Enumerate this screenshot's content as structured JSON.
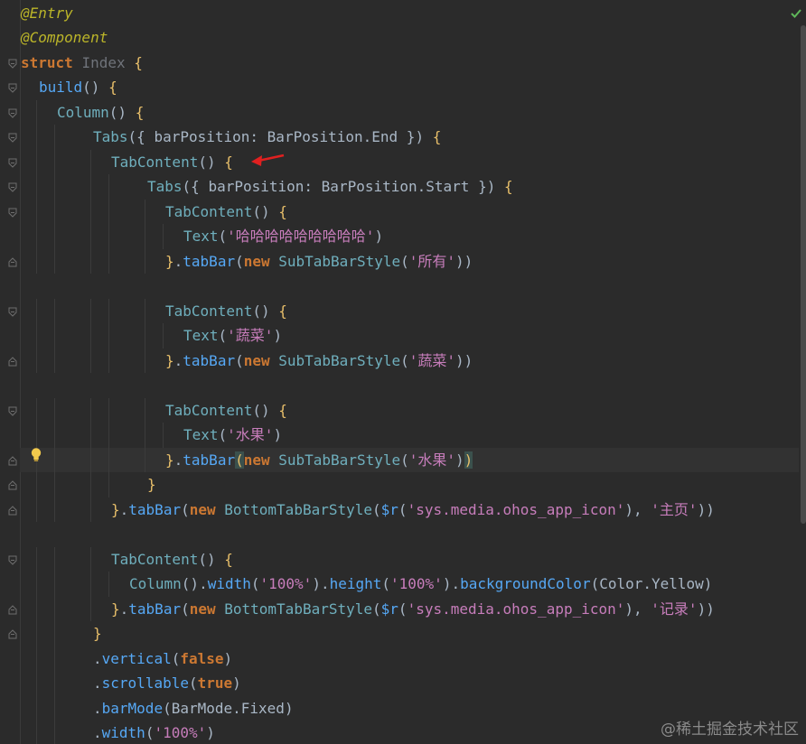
{
  "editor": {
    "status_check_icon": "checkmark-icon",
    "watermark": "@稀土掘金技术社区",
    "lines": [
      [
        {
          "t": "@Entry",
          "c": "annotation"
        }
      ],
      [
        {
          "t": "@Component",
          "c": "annotation"
        }
      ],
      [
        {
          "t": "struct ",
          "c": "kw-bold"
        },
        {
          "t": "Index ",
          "c": "ident-dim"
        },
        {
          "t": "{",
          "c": "br-yellow"
        }
      ],
      [
        {
          "t": "build",
          "c": "fn"
        },
        {
          "t": "() ",
          "c": "plain"
        },
        {
          "t": "{",
          "c": "br-yellow"
        }
      ],
      [
        {
          "t": "Column",
          "c": "comp"
        },
        {
          "t": "() ",
          "c": "plain"
        },
        {
          "t": "{",
          "c": "br-yellow"
        }
      ],
      [
        {
          "t": "Tabs",
          "c": "comp"
        },
        {
          "t": "({ ",
          "c": "plain"
        },
        {
          "t": "barPosition",
          "c": "prop"
        },
        {
          "t": ": ",
          "c": "plain"
        },
        {
          "t": "BarPosition",
          "c": "cls"
        },
        {
          "t": ".End }) ",
          "c": "plain"
        },
        {
          "t": "{",
          "c": "br-yellow"
        }
      ],
      [
        {
          "t": "TabContent",
          "c": "comp"
        },
        {
          "t": "() ",
          "c": "plain"
        },
        {
          "t": "{",
          "c": "br-yellow"
        }
      ],
      [
        {
          "t": "Tabs",
          "c": "comp"
        },
        {
          "t": "({ ",
          "c": "plain"
        },
        {
          "t": "barPosition",
          "c": "prop"
        },
        {
          "t": ": ",
          "c": "plain"
        },
        {
          "t": "BarPosition",
          "c": "cls"
        },
        {
          "t": ".Start }) ",
          "c": "plain"
        },
        {
          "t": "{",
          "c": "br-yellow"
        }
      ],
      [
        {
          "t": "TabContent",
          "c": "comp"
        },
        {
          "t": "() ",
          "c": "plain"
        },
        {
          "t": "{",
          "c": "br-yellow"
        }
      ],
      [
        {
          "t": "Text",
          "c": "comp"
        },
        {
          "t": "(",
          "c": "plain"
        },
        {
          "t": "'哈哈哈哈哈哈哈哈哈'",
          "c": "str-lilac"
        },
        {
          "t": ")",
          "c": "plain"
        }
      ],
      [
        {
          "t": "}",
          "c": "br-yellow"
        },
        {
          "t": ".",
          "c": "plain"
        },
        {
          "t": "tabBar",
          "c": "tabbar"
        },
        {
          "t": "(",
          "c": "plain"
        },
        {
          "t": "new ",
          "c": "kw-bold"
        },
        {
          "t": "SubTabBarStyle",
          "c": "comp"
        },
        {
          "t": "(",
          "c": "plain"
        },
        {
          "t": "'所有'",
          "c": "str-lilac"
        },
        {
          "t": "))",
          "c": "plain"
        }
      ],
      [],
      [
        {
          "t": "TabContent",
          "c": "comp"
        },
        {
          "t": "() ",
          "c": "plain"
        },
        {
          "t": "{",
          "c": "br-yellow"
        }
      ],
      [
        {
          "t": "Text",
          "c": "comp"
        },
        {
          "t": "(",
          "c": "plain"
        },
        {
          "t": "'蔬菜'",
          "c": "str-lilac"
        },
        {
          "t": ")",
          "c": "plain"
        }
      ],
      [
        {
          "t": "}",
          "c": "br-yellow"
        },
        {
          "t": ".",
          "c": "plain"
        },
        {
          "t": "tabBar",
          "c": "tabbar"
        },
        {
          "t": "(",
          "c": "plain"
        },
        {
          "t": "new ",
          "c": "kw-bold"
        },
        {
          "t": "SubTabBarStyle",
          "c": "comp"
        },
        {
          "t": "(",
          "c": "plain"
        },
        {
          "t": "'蔬菜'",
          "c": "str-lilac"
        },
        {
          "t": "))",
          "c": "plain"
        }
      ],
      [],
      [
        {
          "t": "TabContent",
          "c": "comp"
        },
        {
          "t": "() ",
          "c": "plain"
        },
        {
          "t": "{",
          "c": "br-yellow"
        }
      ],
      [
        {
          "t": "Text",
          "c": "comp"
        },
        {
          "t": "(",
          "c": "plain"
        },
        {
          "t": "'水果'",
          "c": "str-lilac"
        },
        {
          "t": ")",
          "c": "plain"
        }
      ],
      [
        {
          "t": "}",
          "c": "br-yellow"
        },
        {
          "t": ".",
          "c": "plain"
        },
        {
          "t": "tabBar",
          "c": "tabbar"
        },
        {
          "t": "(",
          "c": "br-hi"
        },
        {
          "t": "new ",
          "c": "kw-bold"
        },
        {
          "t": "SubTabBarStyle",
          "c": "comp"
        },
        {
          "t": "(",
          "c": "plain"
        },
        {
          "t": "'水果'",
          "c": "str-lilac"
        },
        {
          "t": ")",
          "c": "plain"
        },
        {
          "t": ")",
          "c": "br-hi"
        }
      ],
      [
        {
          "t": "}",
          "c": "br-yellow"
        }
      ],
      [
        {
          "t": "}",
          "c": "br-yellow"
        },
        {
          "t": ".",
          "c": "plain"
        },
        {
          "t": "tabBar",
          "c": "tabbar"
        },
        {
          "t": "(",
          "c": "plain"
        },
        {
          "t": "new ",
          "c": "kw-bold"
        },
        {
          "t": "BottomTabBarStyle",
          "c": "comp"
        },
        {
          "t": "(",
          "c": "plain"
        },
        {
          "t": "$r",
          "c": "dollar"
        },
        {
          "t": "(",
          "c": "plain"
        },
        {
          "t": "'sys.media.ohos_app_icon'",
          "c": "str-lilac"
        },
        {
          "t": "), ",
          "c": "plain"
        },
        {
          "t": "'主页'",
          "c": "str-lilac"
        },
        {
          "t": "))",
          "c": "plain"
        }
      ],
      [],
      [
        {
          "t": "TabContent",
          "c": "comp"
        },
        {
          "t": "() ",
          "c": "plain"
        },
        {
          "t": "{",
          "c": "br-yellow"
        }
      ],
      [
        {
          "t": "Column",
          "c": "comp"
        },
        {
          "t": "().",
          "c": "plain"
        },
        {
          "t": "width",
          "c": "method"
        },
        {
          "t": "(",
          "c": "plain"
        },
        {
          "t": "'100%'",
          "c": "str-lilac"
        },
        {
          "t": ").",
          "c": "plain"
        },
        {
          "t": "height",
          "c": "method"
        },
        {
          "t": "(",
          "c": "plain"
        },
        {
          "t": "'100%'",
          "c": "str-lilac"
        },
        {
          "t": ").",
          "c": "plain"
        },
        {
          "t": "backgroundColor",
          "c": "method"
        },
        {
          "t": "(Color.Yellow)",
          "c": "plain"
        }
      ],
      [
        {
          "t": "}",
          "c": "br-yellow"
        },
        {
          "t": ".",
          "c": "plain"
        },
        {
          "t": "tabBar",
          "c": "tabbar"
        },
        {
          "t": "(",
          "c": "plain"
        },
        {
          "t": "new ",
          "c": "kw-bold"
        },
        {
          "t": "BottomTabBarStyle",
          "c": "comp"
        },
        {
          "t": "(",
          "c": "plain"
        },
        {
          "t": "$r",
          "c": "dollar"
        },
        {
          "t": "(",
          "c": "plain"
        },
        {
          "t": "'sys.media.ohos_app_icon'",
          "c": "str-lilac"
        },
        {
          "t": "), ",
          "c": "plain"
        },
        {
          "t": "'记录'",
          "c": "str-lilac"
        },
        {
          "t": "))",
          "c": "plain"
        }
      ],
      [
        {
          "t": "}",
          "c": "br-yellow"
        }
      ],
      [
        {
          "t": ".",
          "c": "plain"
        },
        {
          "t": "vertical",
          "c": "method"
        },
        {
          "t": "(",
          "c": "plain"
        },
        {
          "t": "false",
          "c": "kw-bold"
        },
        {
          "t": ")",
          "c": "plain"
        }
      ],
      [
        {
          "t": ".",
          "c": "plain"
        },
        {
          "t": "scrollable",
          "c": "method"
        },
        {
          "t": "(",
          "c": "plain"
        },
        {
          "t": "true",
          "c": "kw-bold"
        },
        {
          "t": ")",
          "c": "plain"
        }
      ],
      [
        {
          "t": ".",
          "c": "plain"
        },
        {
          "t": "barMode",
          "c": "method"
        },
        {
          "t": "(BarMode.Fixed)",
          "c": "plain"
        }
      ],
      [
        {
          "t": ".",
          "c": "plain"
        },
        {
          "t": "width",
          "c": "method"
        },
        {
          "t": "(",
          "c": "plain"
        },
        {
          "t": "'100%'",
          "c": "str-lilac"
        },
        {
          "t": ")",
          "c": "plain"
        }
      ]
    ]
  }
}
